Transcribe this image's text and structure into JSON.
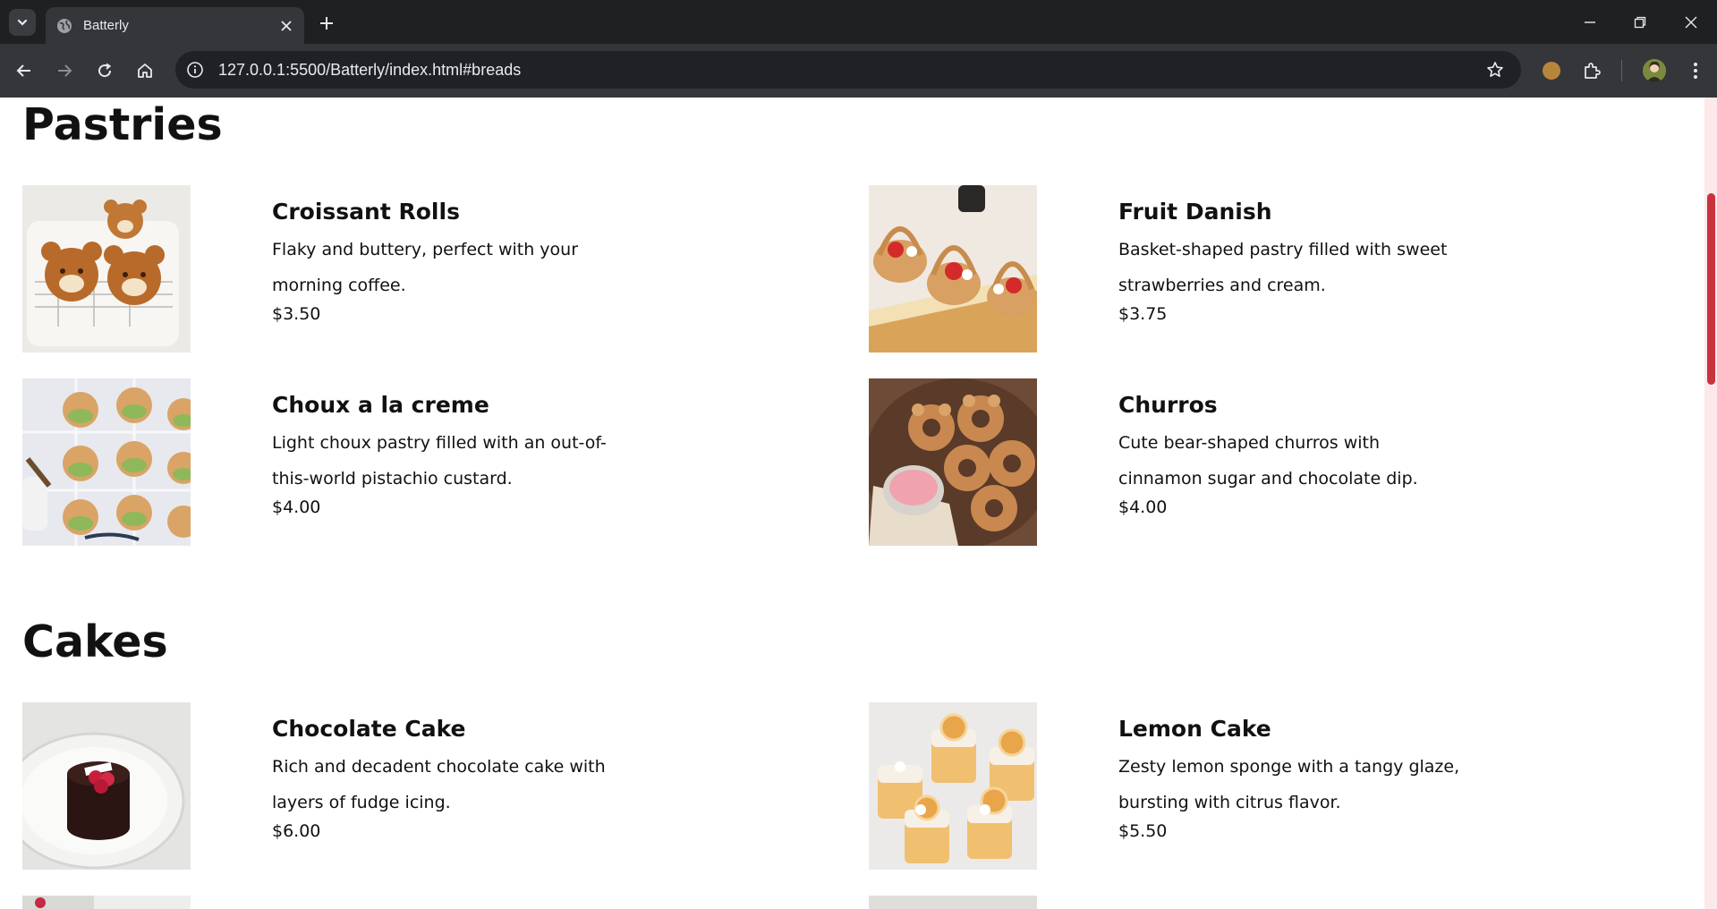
{
  "browser": {
    "tab_title": "Batterly",
    "url": "127.0.0.1:5500/Batterly/index.html#breads"
  },
  "sections": [
    {
      "title": "Pastries",
      "items": [
        {
          "name": "Croissant Rolls",
          "description": "Flaky and buttery, perfect with your morning coffee.",
          "price": "$3.50",
          "image": "bear-croissants-image"
        },
        {
          "name": "Fruit Danish",
          "description": "Basket-shaped pastry filled with sweet strawberries and cream.",
          "price": "$3.75",
          "image": "strawberry-baskets-image"
        },
        {
          "name": "Choux a la creme",
          "description": "Light choux pastry filled with an out-of-this-world pistachio custard.",
          "price": "$4.00",
          "image": "alien-choux-image"
        },
        {
          "name": "Churros",
          "description": "Cute bear-shaped churros with cinnamon sugar and chocolate dip.",
          "price": "$4.00",
          "image": "bear-churros-image"
        }
      ]
    },
    {
      "title": "Cakes",
      "items": [
        {
          "name": "Chocolate Cake",
          "description": "Rich and decadent chocolate cake with layers of fudge icing.",
          "price": "$6.00",
          "image": "chocolate-cake-image"
        },
        {
          "name": "Lemon Cake",
          "description": "Zesty lemon sponge with a tangy glaze, bursting with citrus flavor.",
          "price": "$5.50",
          "image": "lemon-cake-image"
        }
      ]
    }
  ],
  "colors": {
    "scroll_thumb": "#c8333e",
    "scroll_track": "#fde8ea"
  }
}
